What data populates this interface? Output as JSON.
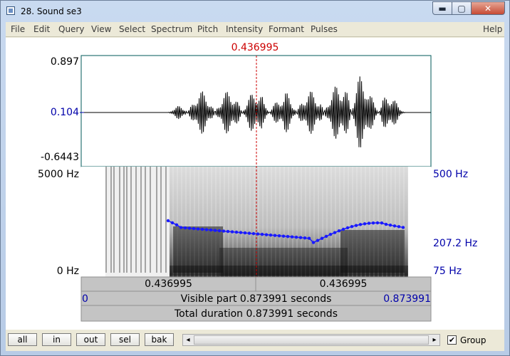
{
  "window": {
    "title": "28. Sound se3",
    "minimize_icon": "minimize-icon",
    "maximize_icon": "maximize-icon",
    "close_icon": "close-icon",
    "min_glyph": "▬",
    "max_glyph": "▢",
    "close_glyph": "✕"
  },
  "menu": {
    "items": [
      "File",
      "Edit",
      "Query",
      "View",
      "Select",
      "Spectrum",
      "Pitch",
      "Intensity",
      "Formant",
      "Pulses"
    ],
    "help": "Help"
  },
  "cursor": {
    "time_label": "0.436995",
    "color": "#cc0000"
  },
  "waveform": {
    "max_label": "0.897",
    "mid_label": "0.104",
    "min_label": "-0.6443"
  },
  "spectrogram": {
    "freq_top_label": "5000 Hz",
    "freq_bottom_label": "0 Hz",
    "pitch_top_label": "500 Hz",
    "pitch_mid_label": "207.2 Hz",
    "pitch_bottom_label": "75 Hz",
    "pitch_color": "#1a1aff"
  },
  "time_bars": {
    "left_time": "0.436995",
    "right_time": "0.436995",
    "visible_start": "0",
    "visible_text": "Visible part 0.873991 seconds",
    "visible_end": "0.873991",
    "total_text": "Total duration 0.873991 seconds"
  },
  "bottom": {
    "buttons": [
      "all",
      "in",
      "out",
      "sel",
      "bak"
    ],
    "scroll_left_icon": "scroll-left-icon",
    "scroll_right_icon": "scroll-right-icon",
    "left_glyph": "◂",
    "right_glyph": "▸",
    "group_checked": true,
    "check_glyph": "✔",
    "group_label": "Group"
  }
}
